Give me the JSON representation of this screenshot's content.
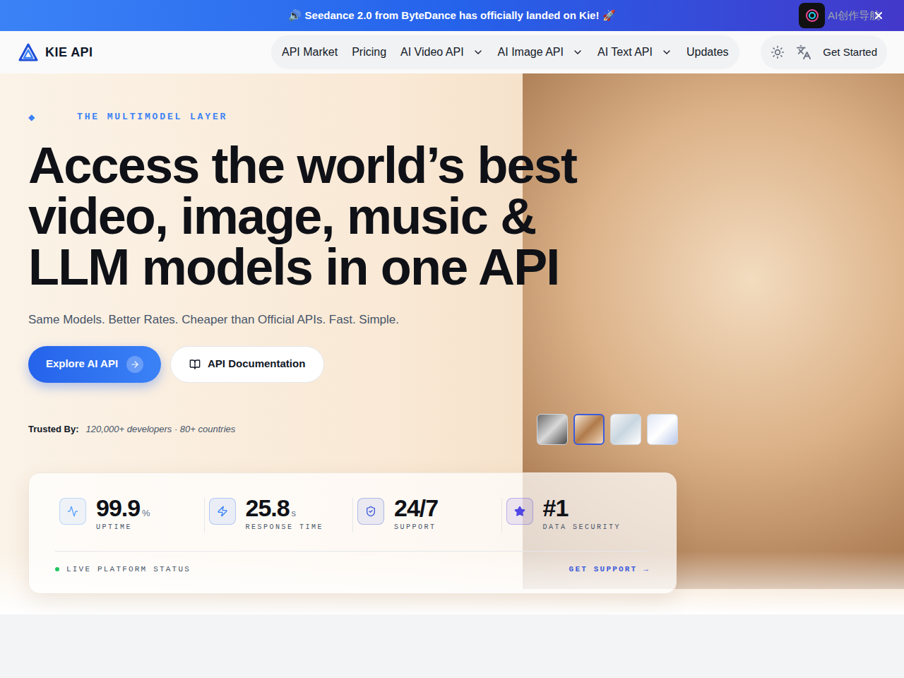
{
  "banner": {
    "text": "🔊 Seedance 2.0 from ByteDance has officially landed on Kie! 🚀",
    "badge": "AI创作导航"
  },
  "nav": {
    "brand": "KIE API",
    "items": [
      {
        "label": "API Market",
        "dropdown": false
      },
      {
        "label": "Pricing",
        "dropdown": false
      },
      {
        "label": "AI Video API",
        "dropdown": true
      },
      {
        "label": "AI Image API",
        "dropdown": true
      },
      {
        "label": "AI Text API",
        "dropdown": true
      },
      {
        "label": "Updates",
        "dropdown": false
      }
    ],
    "cta": "Get Started"
  },
  "hero": {
    "eyebrow_mark": "◆",
    "eyebrow": "THE MULTIMODEL LAYER",
    "title_lines": [
      "Access the world’s best",
      "video, image, music &",
      "LLM models in one API"
    ],
    "subtitle": "Same Models. Better Rates. Cheaper than Official APIs. Fast. Simple.",
    "primary_button": "Explore AI API",
    "secondary_button": "API Documentation",
    "trusted_label": "Trusted By:",
    "trusted_text": "120,000+ developers · 80+ countries",
    "thumbnails": [
      {
        "selected": false
      },
      {
        "selected": true
      },
      {
        "selected": false
      },
      {
        "selected": false
      }
    ]
  },
  "stats": [
    {
      "value": "99.9",
      "unit": "%",
      "label": "UPTIME",
      "color": "#60a5fa"
    },
    {
      "value": "25.8",
      "unit": "s",
      "label": "RESPONSE TIME",
      "color": "#3b82f6"
    },
    {
      "value": "24/7",
      "label": "SUPPORT",
      "color": "#3b5bdb"
    },
    {
      "value": "#1",
      "label": "DATA SECURITY",
      "color": "#4f46e5"
    }
  ],
  "status": {
    "label": "LIVE PLATFORM STATUS",
    "link": "GET SUPPORT →"
  }
}
